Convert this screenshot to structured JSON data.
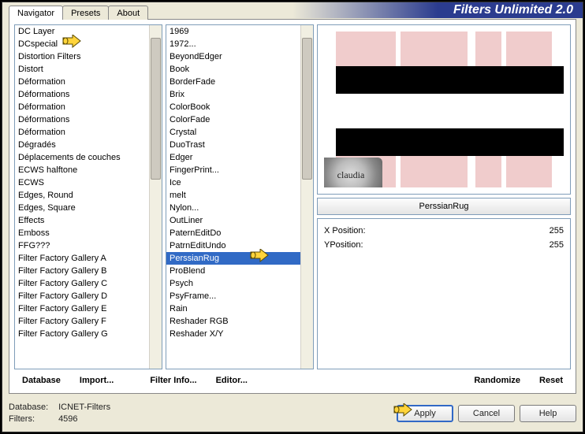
{
  "app_title": "Filters Unlimited 2.0",
  "tabs": [
    "Navigator",
    "Presets",
    "About"
  ],
  "categories": [
    "DC Layer",
    "DCspecial",
    "Distortion Filters",
    "Distort",
    "Déformation",
    "Déformations",
    "Déformation",
    "Déformations",
    "Déformation",
    "Dégradés",
    "Déplacements de couches",
    "ECWS halftone",
    "ECWS",
    "Edges, Round",
    "Edges, Square",
    "Effects",
    "Emboss",
    "FFG???",
    "Filter Factory Gallery A",
    "Filter Factory Gallery B",
    "Filter Factory Gallery C",
    "Filter Factory Gallery D",
    "Filter Factory Gallery E",
    "Filter Factory Gallery F",
    "Filter Factory Gallery G"
  ],
  "filters": [
    "1969",
    "1972...",
    "BeyondEdger",
    "Book",
    "BorderFade",
    "Brix",
    "ColorBook",
    "ColorFade",
    "Crystal",
    "DuoTrast",
    "Edger",
    "FingerPrint...",
    "Ice",
    "melt",
    "Nylon...",
    "OutLiner",
    "PaternEditDo",
    "PatrnEditUndo",
    "PerssianRug",
    "ProBlend",
    "Psych",
    "PsyFrame...",
    "Rain",
    "Reshader RGB",
    "Reshader X/Y"
  ],
  "selected_filter_index": 18,
  "current_filter_name": "PerssianRug",
  "sliders": [
    {
      "label": "X Position:",
      "value": "255"
    },
    {
      "label": "YPosition:",
      "value": "255"
    }
  ],
  "left_buttons": {
    "database": "Database",
    "import": "Import...",
    "filterinfo": "Filter Info...",
    "editor": "Editor..."
  },
  "right_buttons": {
    "randomize": "Randomize",
    "reset": "Reset"
  },
  "status": {
    "db_label": "Database:",
    "db_value": "ICNET-Filters",
    "filters_label": "Filters:",
    "filters_value": "4596"
  },
  "win_buttons": {
    "apply": "Apply",
    "cancel": "Cancel",
    "help": "Help"
  },
  "icons": {
    "pointer": "pointer-icon"
  },
  "watermark_text": "claudia"
}
